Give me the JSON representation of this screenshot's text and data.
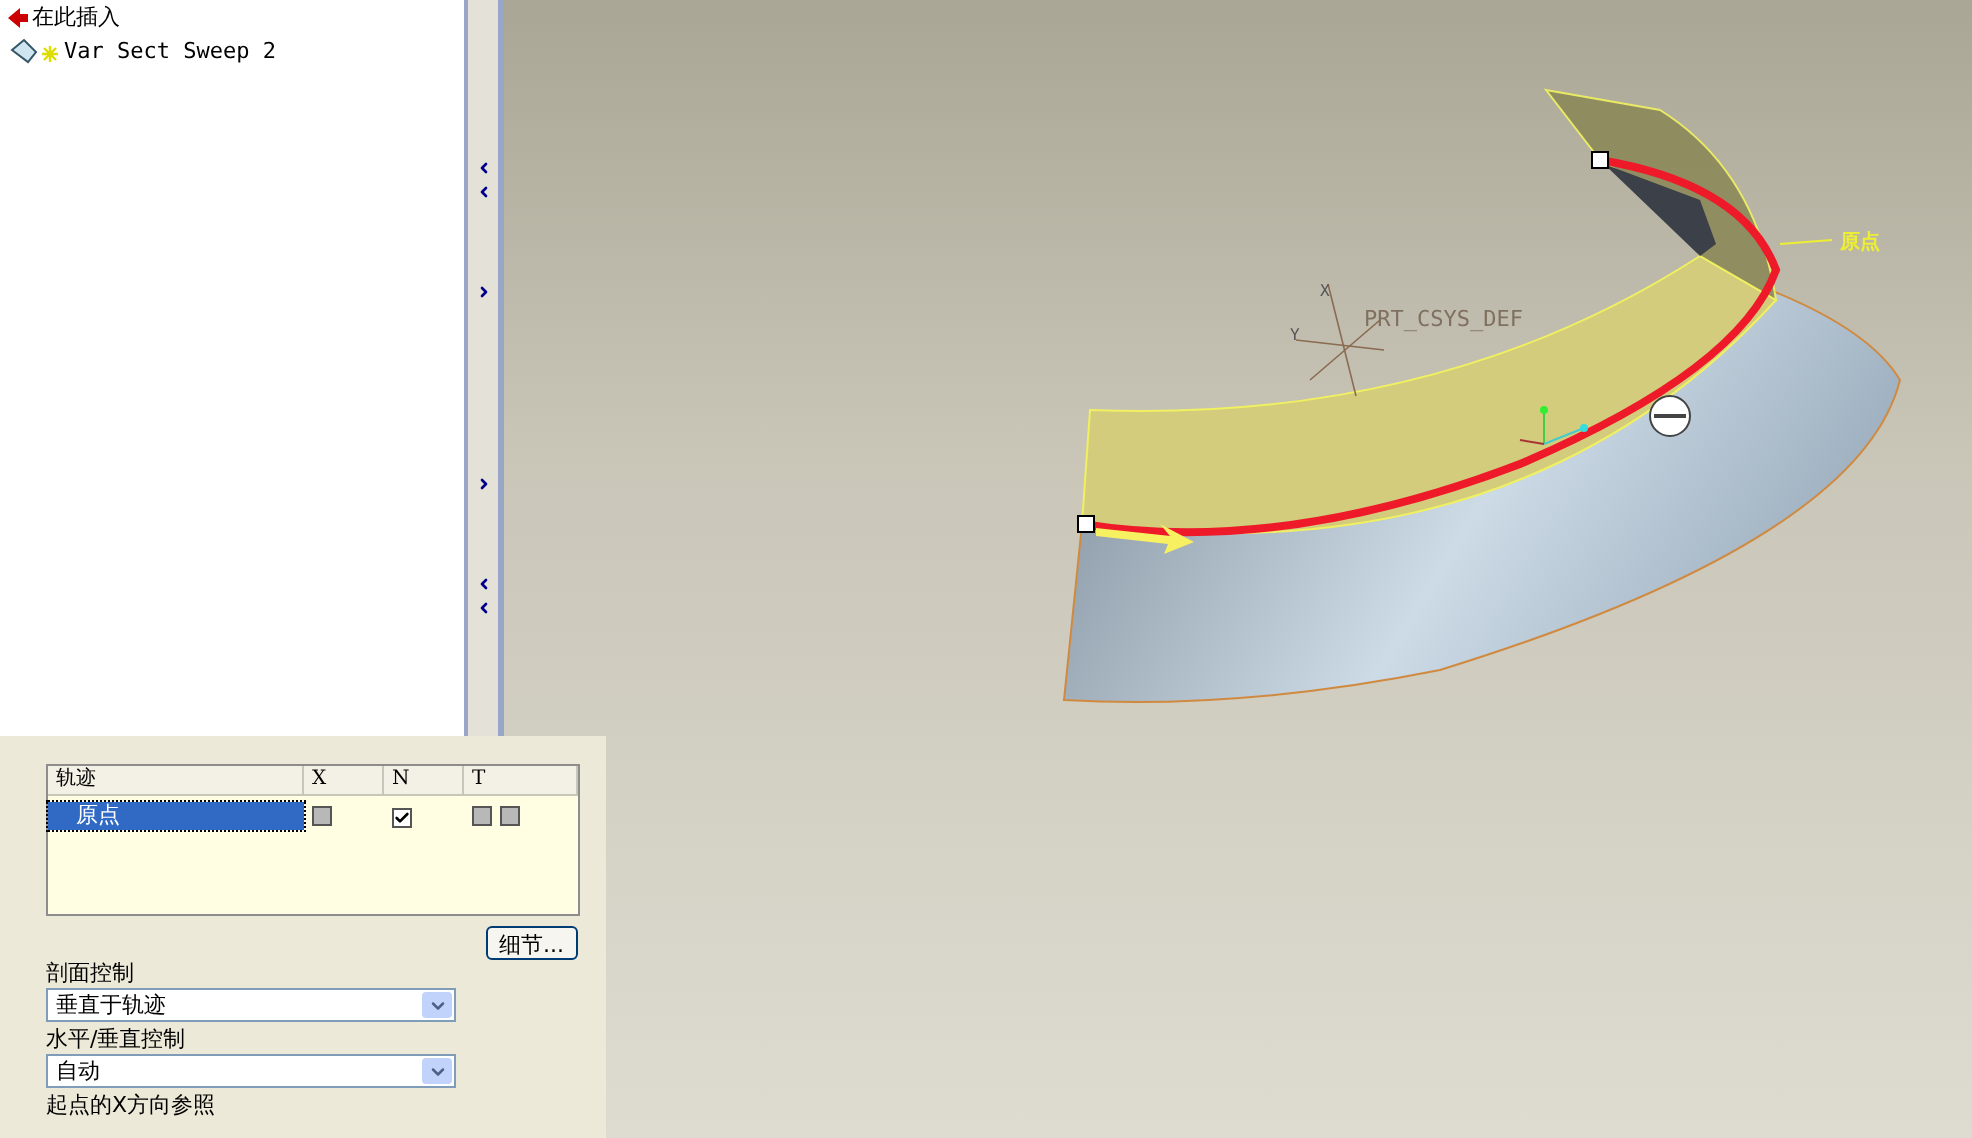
{
  "tree": {
    "insert_here": "在此插入",
    "items": [
      {
        "label": "Var Sect Sweep 2"
      }
    ]
  },
  "trajectory_table": {
    "columns": [
      "轨迹",
      "X",
      "N",
      "T"
    ],
    "rows": [
      {
        "name": "原点",
        "selected": true,
        "x_checked": false,
        "n_checked": true,
        "t_checked": [
          false,
          false
        ]
      }
    ]
  },
  "details_button": "细节...",
  "section_control": {
    "label": "剖面控制",
    "value": "垂直于轨迹"
  },
  "hv_control": {
    "label": "水平/垂直控制",
    "value": "自动"
  },
  "x_reference_label": "起点的X方向参照",
  "viewport": {
    "csys_label": "PRT_CSYS_DEF",
    "csys_axes": [
      "X",
      "Y"
    ],
    "origin_label": "原点"
  }
}
